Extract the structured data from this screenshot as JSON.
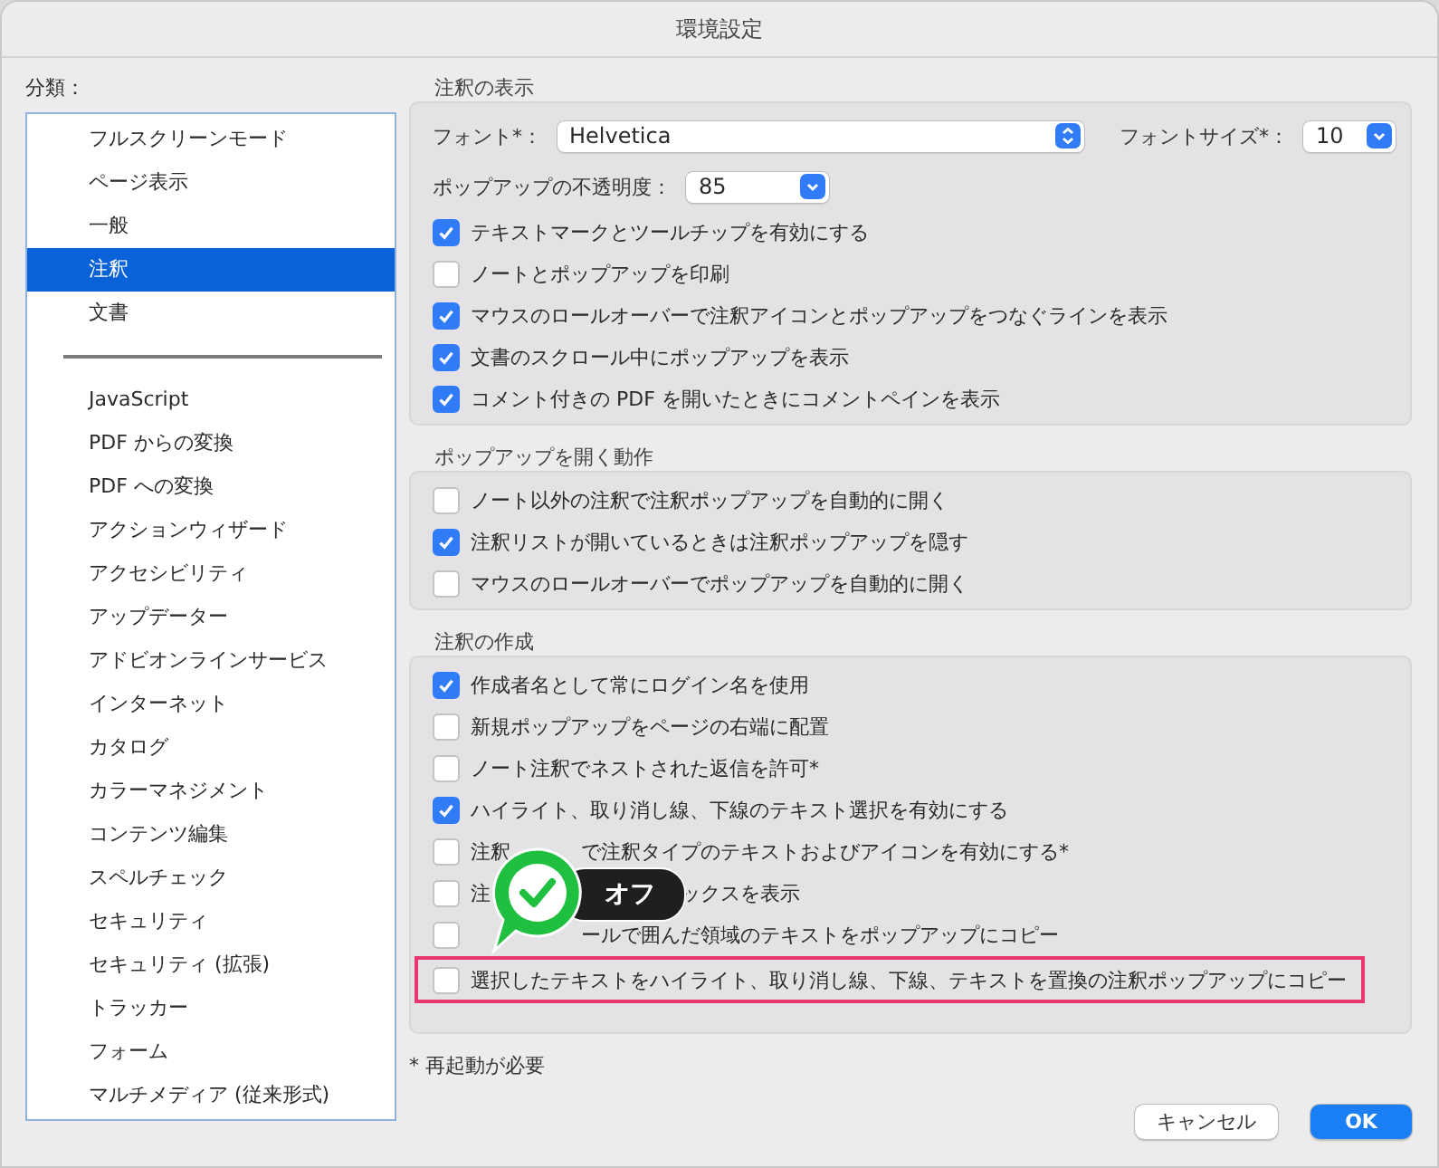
{
  "window": {
    "title": "環境設定"
  },
  "sidebar": {
    "label": "分類：",
    "groups": [
      [
        {
          "label": "フルスクリーンモード",
          "selected": false
        },
        {
          "label": "ページ表示",
          "selected": false
        },
        {
          "label": "一般",
          "selected": false
        },
        {
          "label": "注釈",
          "selected": true
        },
        {
          "label": "文書",
          "selected": false
        }
      ],
      [
        {
          "label": "JavaScript",
          "selected": false
        },
        {
          "label": "PDF からの変換",
          "selected": false
        },
        {
          "label": "PDF への変換",
          "selected": false
        },
        {
          "label": "アクションウィザード",
          "selected": false
        },
        {
          "label": "アクセシビリティ",
          "selected": false
        },
        {
          "label": "アップデーター",
          "selected": false
        },
        {
          "label": "アドビオンラインサービス",
          "selected": false
        },
        {
          "label": "インターネット",
          "selected": false
        },
        {
          "label": "カタログ",
          "selected": false
        },
        {
          "label": "カラーマネジメント",
          "selected": false
        },
        {
          "label": "コンテンツ編集",
          "selected": false
        },
        {
          "label": "スペルチェック",
          "selected": false
        },
        {
          "label": "セキュリティ",
          "selected": false
        },
        {
          "label": "セキュリティ (拡張)",
          "selected": false
        },
        {
          "label": "トラッカー",
          "selected": false
        },
        {
          "label": "フォーム",
          "selected": false
        },
        {
          "label": "マルチメディア (従来形式)",
          "selected": false
        }
      ]
    ]
  },
  "sections": [
    {
      "title": "注釈の表示",
      "dropdown_rows": [
        [
          {
            "label": "フォント*：",
            "value": "Helvetica",
            "kind": "stepper"
          },
          {
            "label": "フォントサイズ*：",
            "value": "10",
            "kind": "menu"
          }
        ],
        [
          {
            "label": "ポップアップの不透明度：",
            "value": "85",
            "kind": "menu"
          }
        ]
      ],
      "options": [
        {
          "segments": [
            "テキストマークとツールチップを有効にする"
          ],
          "checked": true
        },
        {
          "segments": [
            "ノートとポップアップを印刷"
          ],
          "checked": false
        },
        {
          "segments": [
            "マウスのロールオーバーで注釈アイコンとポップアップをつなぐラインを表示"
          ],
          "checked": true
        },
        {
          "segments": [
            "文書のスクロール中にポップアップを表示"
          ],
          "checked": true
        },
        {
          "segments": [
            "コメント付きの PDF を開いたときにコメントペインを表示"
          ],
          "checked": true
        }
      ]
    },
    {
      "title": "ポップアップを開く動作",
      "options": [
        {
          "segments": [
            "ノート以外の注釈で注釈ポップアップを自動的に開く"
          ],
          "checked": false
        },
        {
          "segments": [
            "注釈リストが開いているときは注釈ポップアップを隠す"
          ],
          "checked": true
        },
        {
          "segments": [
            "マウスのロールオーバーでポップアップを自動的に開く"
          ],
          "checked": false
        }
      ]
    },
    {
      "title": "注釈の作成",
      "options": [
        {
          "segments": [
            "作成者名として常にログイン名を使用"
          ],
          "checked": true,
          "highlighted": false
        },
        {
          "segments": [
            "新規ポップアップをページの右端に配置"
          ],
          "checked": false,
          "highlighted": false
        },
        {
          "segments": [
            "ノート注釈でネストされた返信を許可*"
          ],
          "checked": false,
          "highlighted": false
        },
        {
          "segments": [
            "ハイライト、取り消し線、下線のテキスト選択を有効にする"
          ],
          "checked": true,
          "highlighted": false
        },
        {
          "segments": [
            "注釈",
            "で注釈タイプのテキストおよびアイコンを有効にする*"
          ],
          "checked": false,
          "highlighted": false
        },
        {
          "segments": [
            "注",
            "ックスを表示"
          ],
          "checked": false,
          "highlighted": false
        },
        {
          "segments": [
            "ールで囲んだ領域のテキストをポップアップにコピー"
          ],
          "checked": false,
          "highlighted": false
        },
        {
          "segments": [
            "選択したテキストをハイライト、取り消し線、下線、テキストを置換の注釈ポップアップにコピー"
          ],
          "checked": false,
          "highlighted": true
        }
      ]
    }
  ],
  "overlay": {
    "label": "オフ"
  },
  "footnote": "* 再起動が必要",
  "buttons": [
    {
      "label": "キャンセル",
      "kind": "plain"
    },
    {
      "label": "OK",
      "kind": "default"
    }
  ]
}
